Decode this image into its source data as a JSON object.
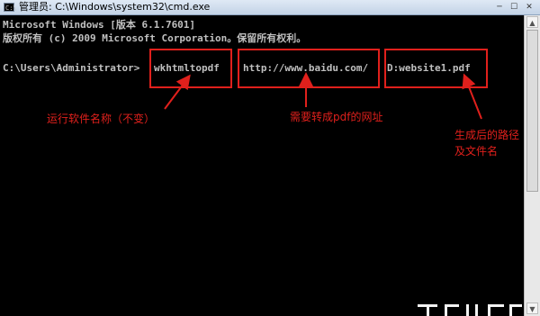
{
  "window": {
    "icon_label": "C:\\",
    "title": "管理员: C:\\Windows\\system32\\cmd.exe",
    "minimize_glyph": "─",
    "maximize_glyph": "☐",
    "close_glyph": "✕"
  },
  "console": {
    "line1": "Microsoft Windows [版本 6.1.7601]",
    "line2": "版权所有 (c) 2009 Microsoft Corporation。保留所有权利。",
    "prompt": "C:\\Users\\Administrator>",
    "exe": "wkhtmltopdf",
    "url": "http://www.baidu.com/",
    "output": "D:website1.pdf"
  },
  "annotations": {
    "exe_note": "运行软件名称（不变）",
    "url_note": "需要转成pdf的网址",
    "output_note_line1": "生成后的路径",
    "output_note_line2": "及文件名"
  },
  "colors": {
    "annotation": "#e0201c",
    "console_text": "#c0c0c0",
    "console_bg": "#000000"
  },
  "scrollbar": {
    "up_glyph": "▲",
    "down_glyph": "▼"
  }
}
